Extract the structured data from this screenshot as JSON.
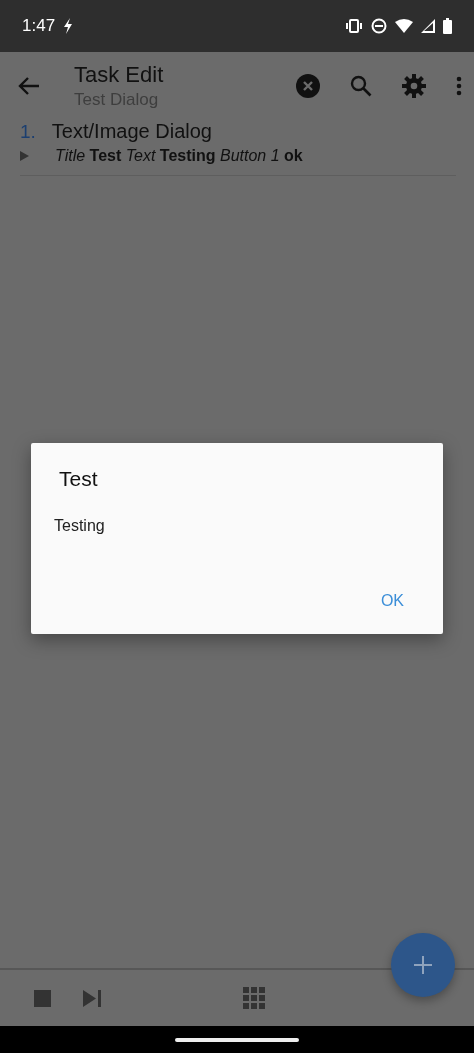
{
  "status_bar": {
    "time": "1:47"
  },
  "app_bar": {
    "title": "Task Edit",
    "subtitle": "Test Dialog"
  },
  "actions": [
    {
      "number": "1.",
      "name": "Text/Image Dialog",
      "params": "*Title* **Test** *Text* **Testing** *Button 1* **ok**"
    }
  ],
  "dialog": {
    "title": "Test",
    "message": "Testing",
    "buttons": [
      "OK"
    ]
  }
}
